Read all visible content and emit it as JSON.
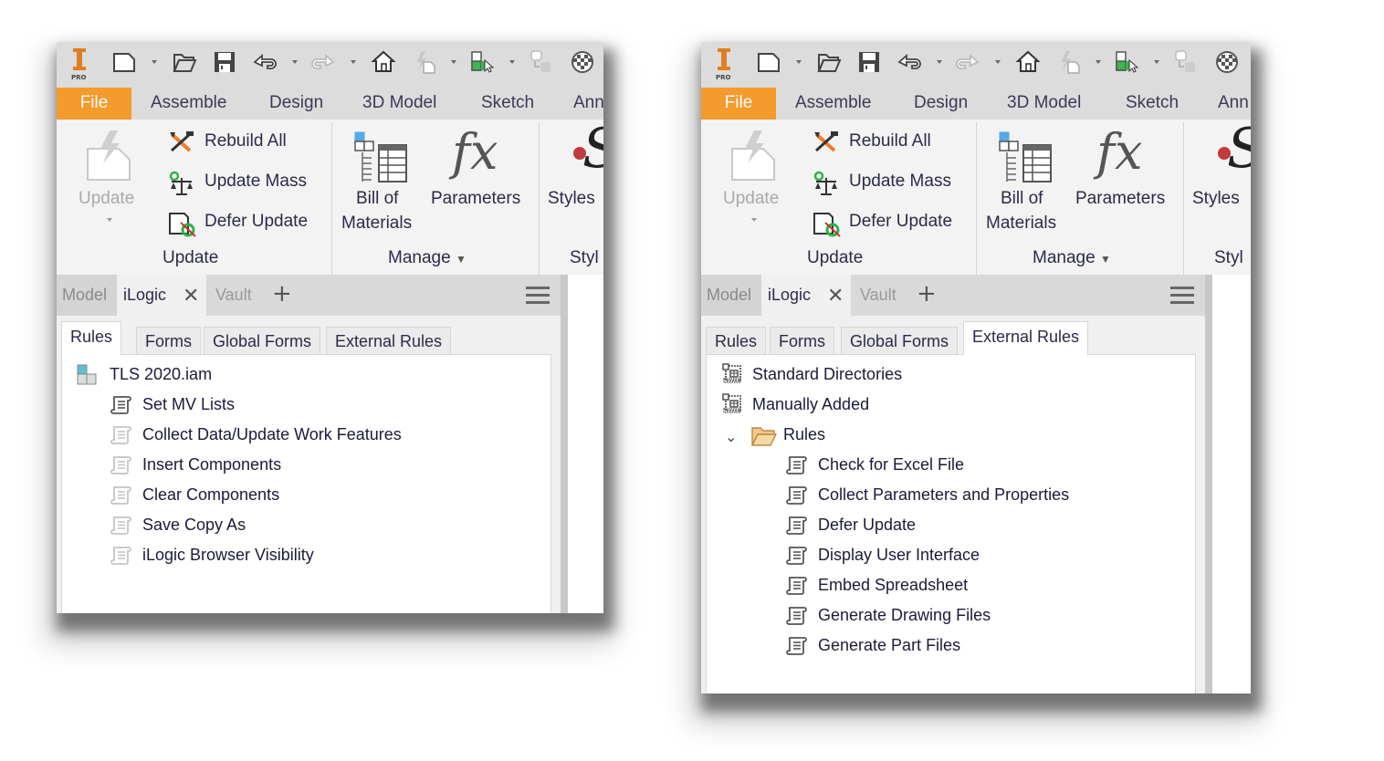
{
  "app": {
    "logo_label": "PRO",
    "accent_color": "#f59a2c"
  },
  "quick_access": {
    "icons": [
      "new-document-icon",
      "open-folder-icon",
      "save-icon",
      "undo-icon",
      "redo-icon",
      "home-icon",
      "update-icon",
      "select-icon",
      "link-icon",
      "appearance-icon"
    ]
  },
  "ribbon_tabs": [
    "File",
    "Assemble",
    "Design",
    "3D Model",
    "Sketch",
    "Ann"
  ],
  "ribbon": {
    "update_button": "Update",
    "rebuild_all": "Rebuild All",
    "update_mass": "Update Mass",
    "defer_update": "Defer Update",
    "update_group": "Update",
    "bom_line1": "Bill of",
    "bom_line2": "Materials",
    "parameters": "Parameters",
    "styles": "Styles",
    "manage_group": "Manage",
    "style_group": "Styl"
  },
  "browser": {
    "tabs": {
      "model": "Model",
      "ilogic": "iLogic",
      "vault": "Vault",
      "close": "✕",
      "add": "+"
    }
  },
  "ilogic_tabs": [
    "Rules",
    "Forms",
    "Global Forms",
    "External Rules"
  ],
  "left_window": {
    "active_tab": "Rules",
    "document": "TLS 2020.iam",
    "rules": [
      {
        "label": "Set MV Lists",
        "enabled": true
      },
      {
        "label": "Collect Data/Update Work Features",
        "enabled": false
      },
      {
        "label": "Insert Components",
        "enabled": false
      },
      {
        "label": "Clear Components",
        "enabled": false
      },
      {
        "label": "Save Copy As",
        "enabled": false
      },
      {
        "label": "iLogic Browser Visibility",
        "enabled": false
      }
    ]
  },
  "right_window": {
    "active_tab": "External Rules",
    "groups": [
      "Standard Directories",
      "Manually Added"
    ],
    "folder": "Rules",
    "folder_expanded": true,
    "rules": [
      "Check for Excel File",
      "Collect Parameters and Properties",
      "Defer Update",
      "Display User Interface",
      "Embed Spreadsheet",
      "Generate Drawing Files",
      "Generate Part Files"
    ]
  }
}
